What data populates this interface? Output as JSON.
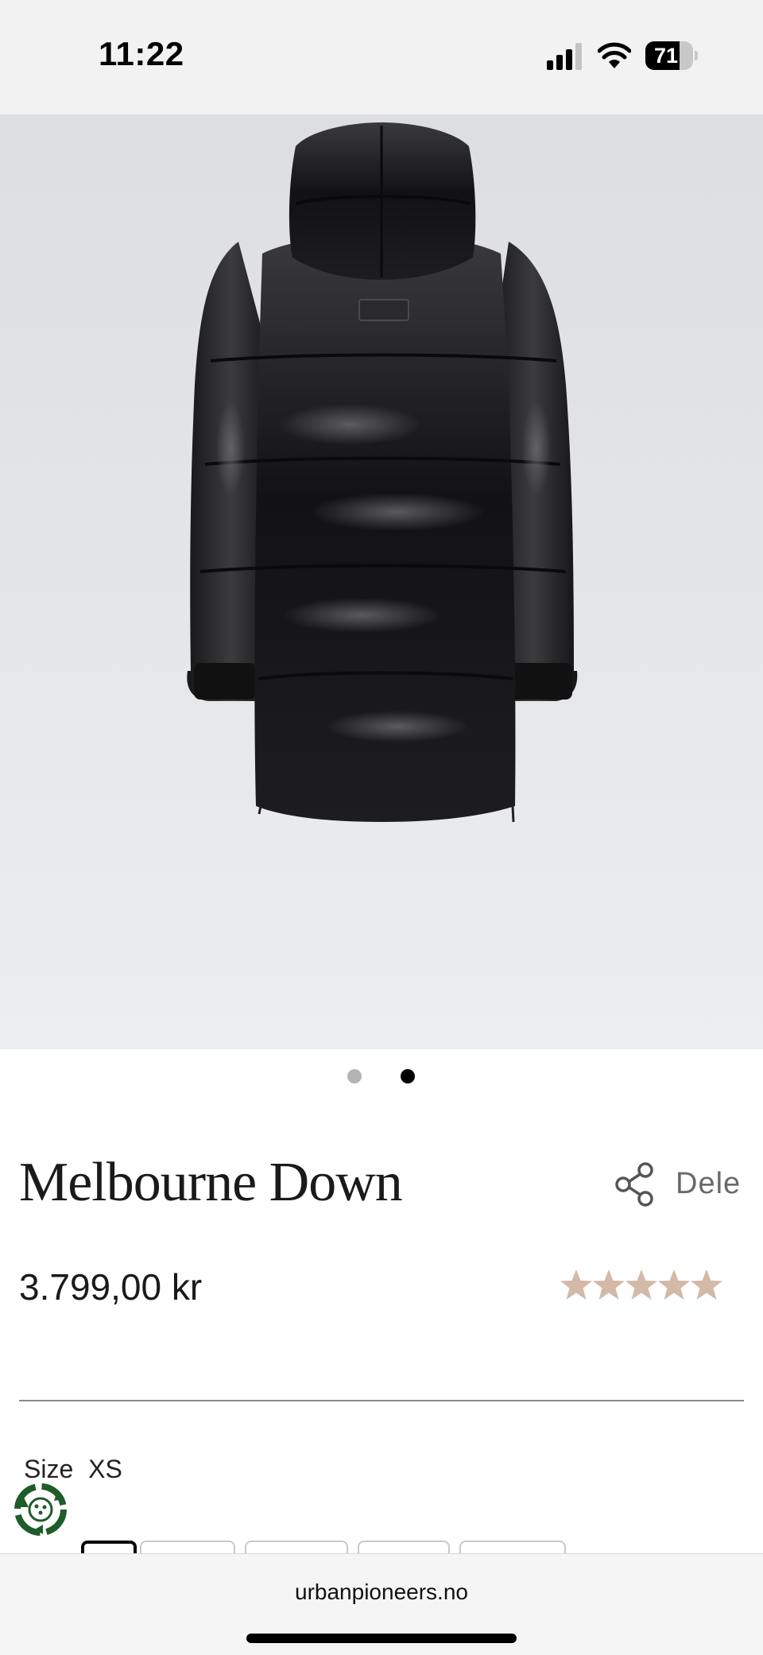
{
  "status_bar": {
    "time": "11:22",
    "battery_level": "71",
    "battery_fraction": 0.71
  },
  "gallery": {
    "image_alt": "Black down jacket, back view",
    "slide_count": 2,
    "active_slide": 2
  },
  "product": {
    "title": "Melbourne Down",
    "price": "3.799,00 kr",
    "rating": 5,
    "rating_max": 5,
    "star_color": "#d4b8a8"
  },
  "share": {
    "label": "Dele",
    "icon": "share-icon"
  },
  "size": {
    "label": "Size",
    "selected": "XS",
    "options_visible": 6
  },
  "eco_badge": {
    "icon": "eco-recycle-badge-icon",
    "color": "#1e5c2a"
  },
  "browser": {
    "url": "urbanpioneers.no"
  }
}
